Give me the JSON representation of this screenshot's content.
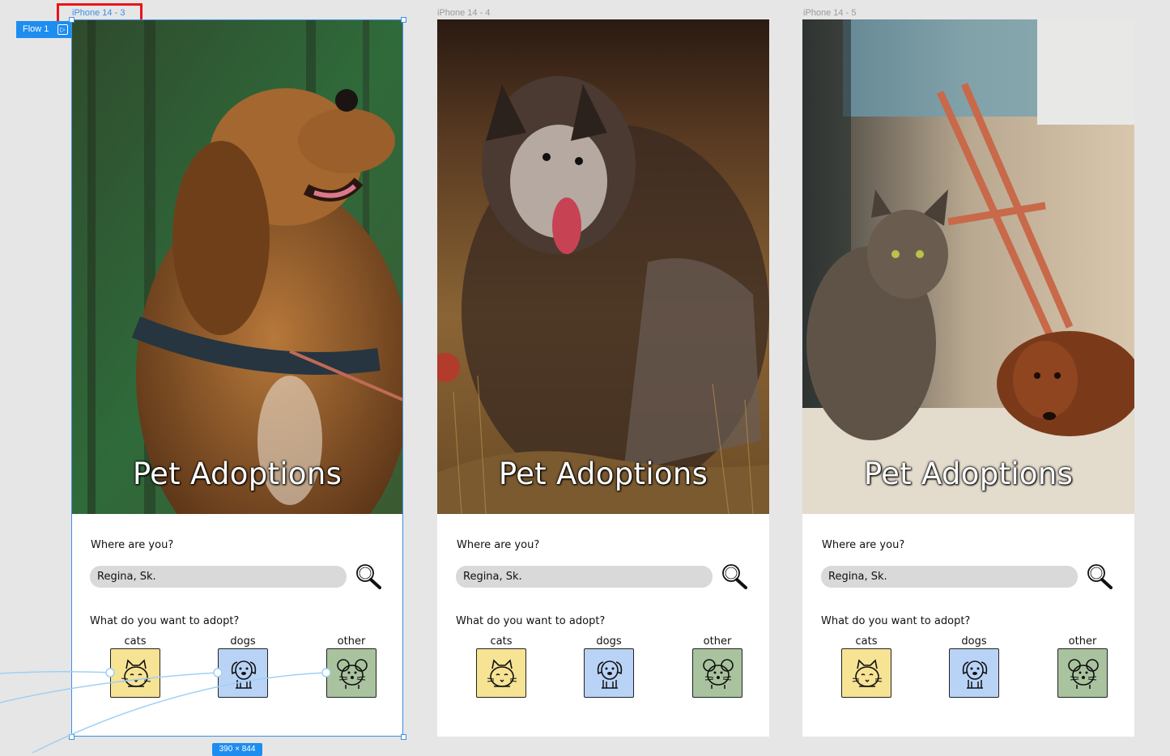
{
  "canvas": {
    "background": "#e6e6e6",
    "flow_label": "Flow 1",
    "selection_size": "390 × 844",
    "selection_color": "#3b8fe6",
    "highlight_color": "#e8141a"
  },
  "frames": [
    {
      "title": "iPhone 14 - 3",
      "selected": true,
      "photo": "dog-forest"
    },
    {
      "title": "iPhone 14 - 4",
      "selected": false,
      "photo": "dog-field"
    },
    {
      "title": "iPhone 14 - 5",
      "selected": false,
      "photo": "cat-and-dog-indoors"
    }
  ],
  "screen": {
    "hero_title": "Pet Adoptions",
    "where_label": "Where are you?",
    "location_value": "Regina, Sk.",
    "search_icon": "magnifier-icon",
    "adopt_label": "What do you want to adopt?",
    "categories": [
      {
        "label": "cats",
        "icon": "cat-icon",
        "color": "#f7e394"
      },
      {
        "label": "dogs",
        "icon": "dog-icon",
        "color": "#b9d3f7"
      },
      {
        "label": "other",
        "icon": "mouse-icon",
        "color": "#a9c39f"
      }
    ]
  }
}
